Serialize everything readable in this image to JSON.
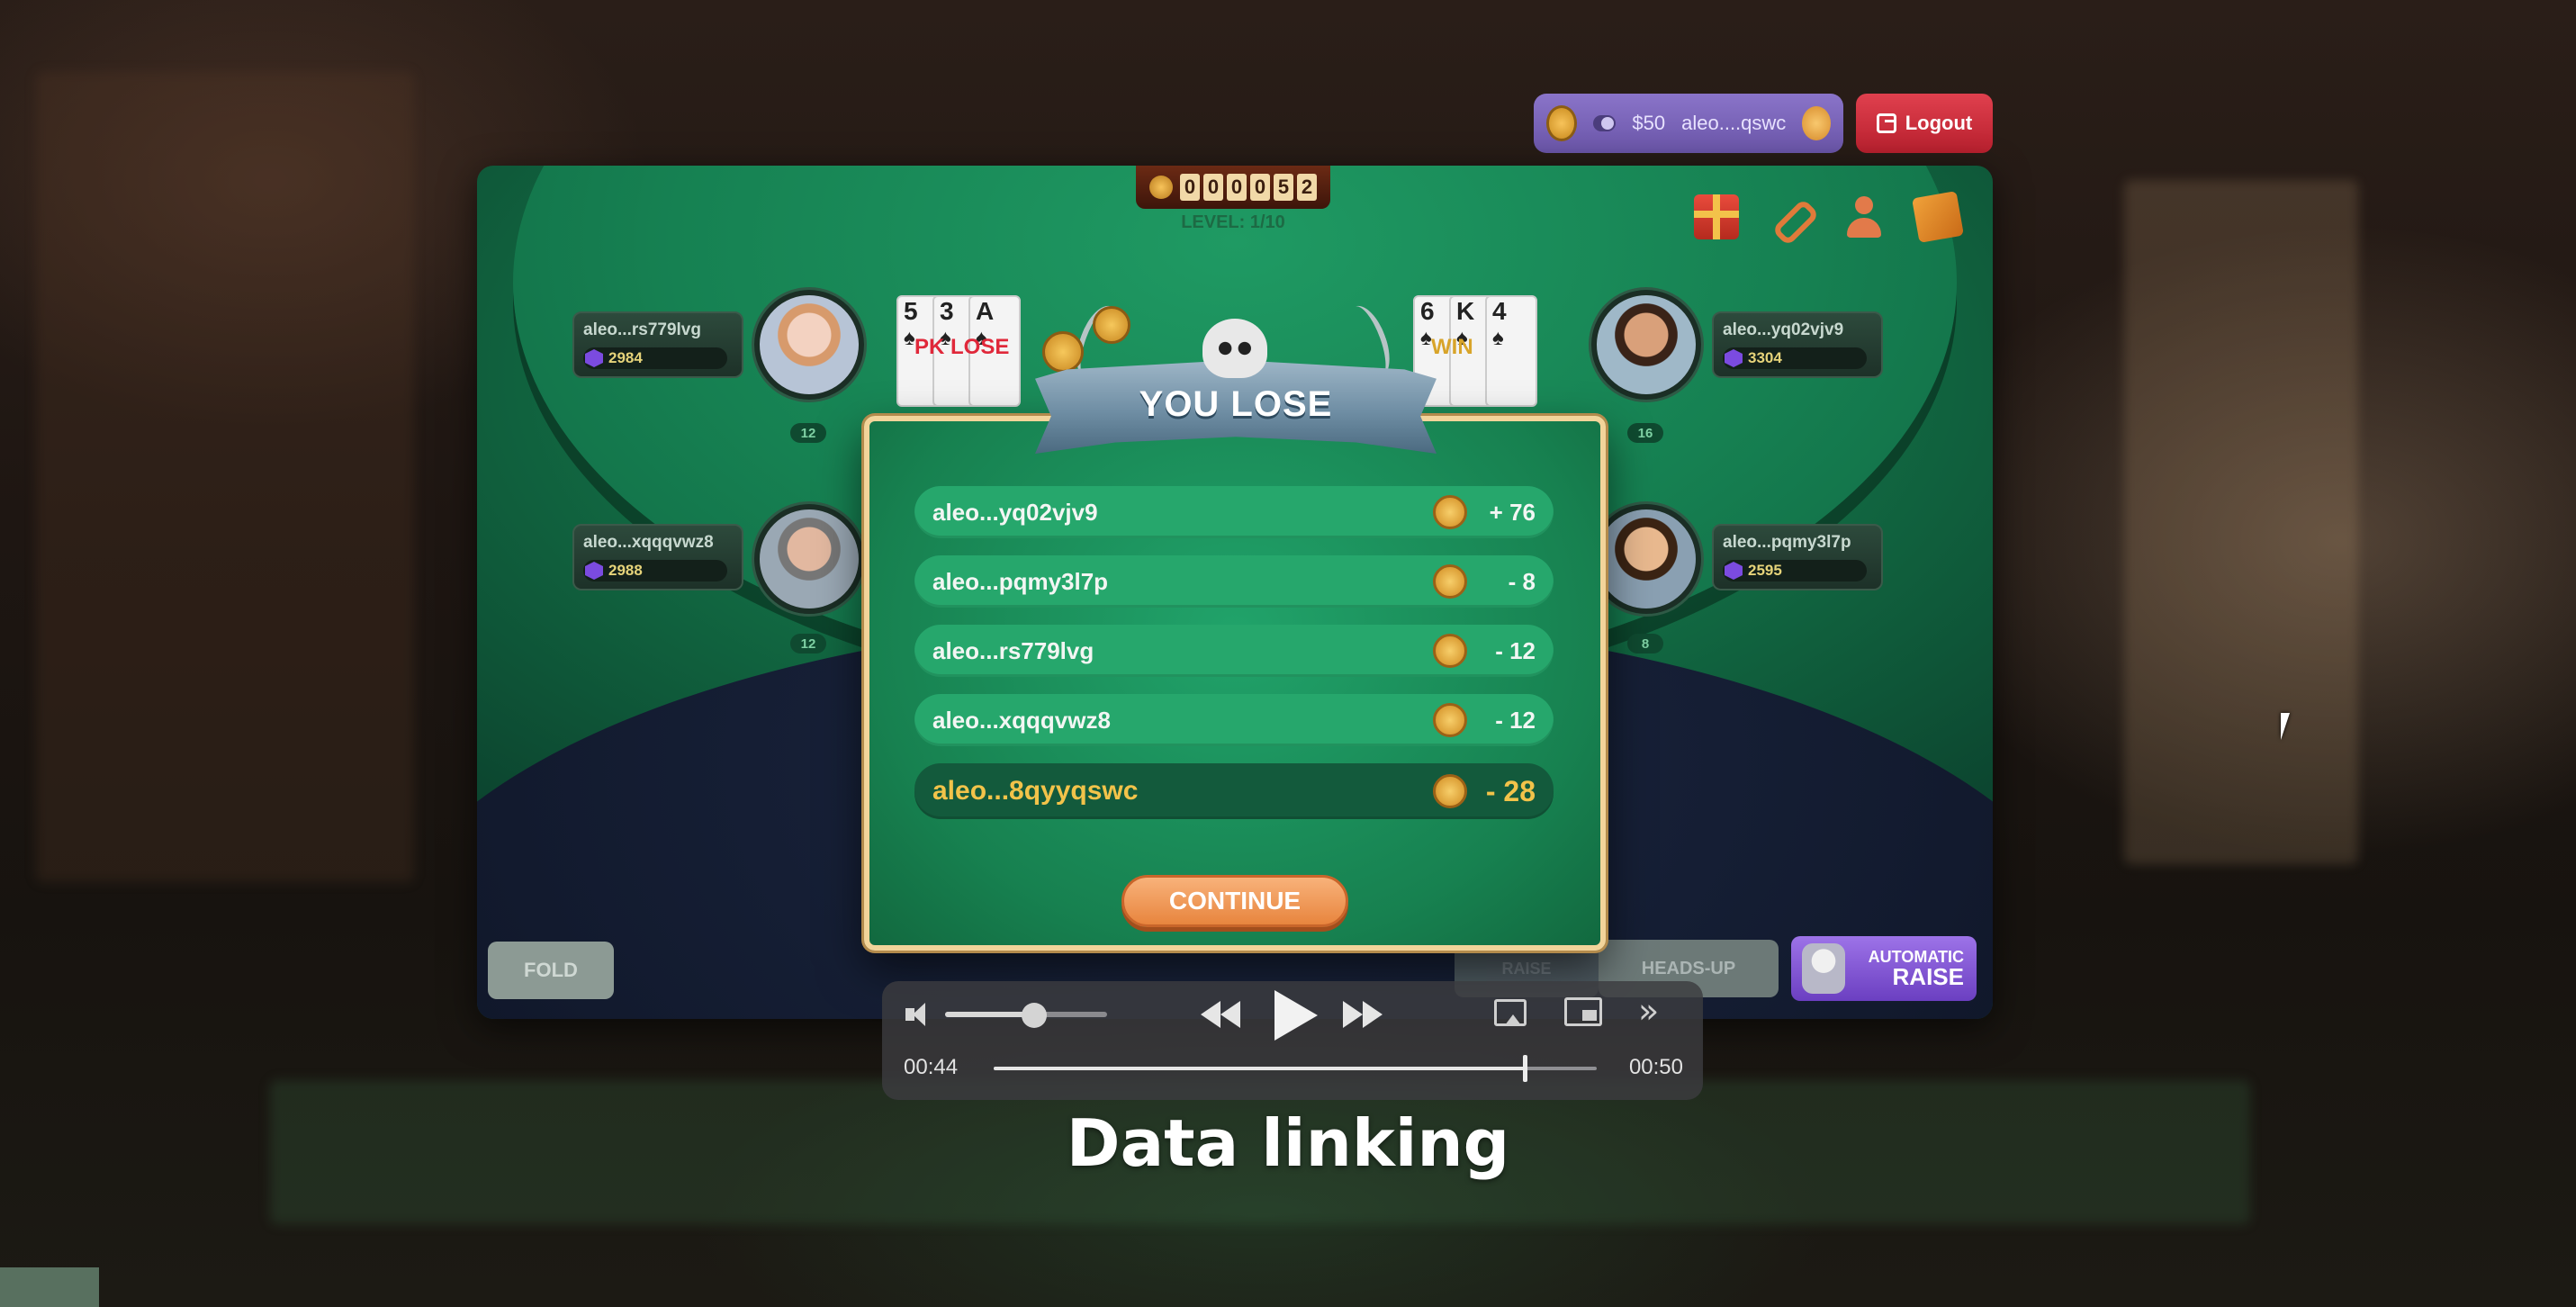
{
  "account": {
    "balance": "$50",
    "wallet": "aleo....qswc",
    "logout_label": "Logout"
  },
  "game": {
    "counter_digits": [
      "0",
      "0",
      "0",
      "0",
      "5",
      "2"
    ],
    "level": "LEVEL: 1/10",
    "top_icons": [
      "gift-icon",
      "link-icon",
      "profile-icon",
      "cards-icon"
    ],
    "players": [
      {
        "name": "aleo...rs779lvg",
        "balance": "2984",
        "seat": "12"
      },
      {
        "name": "aleo...xqqqvwz8",
        "balance": "2988",
        "seat": "12"
      },
      {
        "name": "aleo...yq02vjv9",
        "balance": "3304",
        "seat": "16"
      },
      {
        "name": "aleo...pqmy3l7p",
        "balance": "2595",
        "seat": "8"
      }
    ],
    "hands": [
      {
        "cards": [
          "5",
          "3",
          "A"
        ],
        "result": "PK LOSE"
      },
      {
        "cards": [
          "6",
          "K",
          "4"
        ],
        "result": "WIN"
      }
    ],
    "buttons": {
      "fold": "FOLD",
      "raise": "RAISE",
      "heads_up": "HEADS-UP",
      "auto_small": "AUTOMATIC",
      "auto_big": "RAISE"
    }
  },
  "result": {
    "title": "YOU LOSE",
    "rows": [
      {
        "name": "aleo...yq02vjv9",
        "delta": "+ 76"
      },
      {
        "name": "aleo...pqmy3l7p",
        "delta": "- 8"
      },
      {
        "name": "aleo...rs779lvg",
        "delta": "- 12"
      },
      {
        "name": "aleo...xqqqvwz8",
        "delta": "- 12"
      }
    ],
    "self_row": {
      "name": "aleo...8qyyqswc",
      "delta": "- 28"
    },
    "continue_label": "CONTINUE"
  },
  "player_controls": {
    "time_current": "00:44",
    "time_total": "00:50",
    "progress": 0.88,
    "volume": 0.55
  },
  "caption": "Data linking",
  "colors": {
    "table_felt": "#178150",
    "self_highlight": "#f2c34a",
    "logout": "#d0303e",
    "auto_raise": "#8a5ad8",
    "continue": "#f19a52"
  }
}
